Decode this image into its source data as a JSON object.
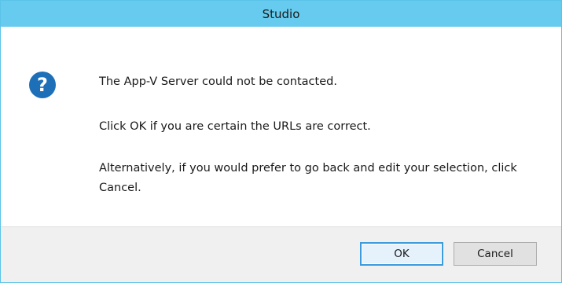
{
  "window": {
    "title": "Studio"
  },
  "message": {
    "icon": "question-icon",
    "line1": "The App-V Server could not be contacted.",
    "line2": "Click OK if you are certain the URLs are correct.",
    "line3": "Alternatively, if you would prefer to go back and edit your selection, click Cancel."
  },
  "buttons": {
    "ok_label": "OK",
    "cancel_label": "Cancel"
  },
  "colors": {
    "titlebar": "#66cbee",
    "icon": "#1d6fb8",
    "footer": "#f0f0f0",
    "default_button_border": "#3c9bdc"
  }
}
